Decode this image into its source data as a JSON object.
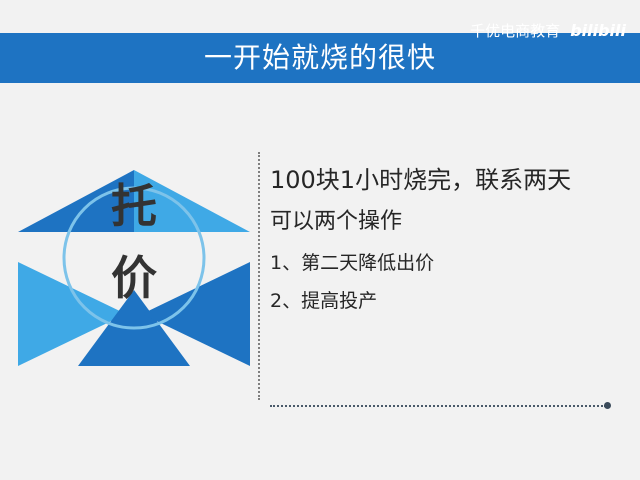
{
  "slide": {
    "title": "一开始就烧的很快",
    "watermark": {
      "text": "千优电商教育",
      "brand": "bilibili"
    },
    "graphic": {
      "char_top": "托",
      "char_bottom": "价",
      "colors": {
        "dark_blue": "#1e73c2",
        "light_blue": "#3fa9e6",
        "text_dark": "#333333"
      }
    },
    "content": {
      "line1": "100块1小时烧完，联系两天",
      "line2": "可以两个操作",
      "item1": "1、第二天降低出价",
      "item2": "2、提高投产"
    },
    "colors": {
      "title_bar": "#1e73c2",
      "background": "#f2f2f2"
    }
  }
}
